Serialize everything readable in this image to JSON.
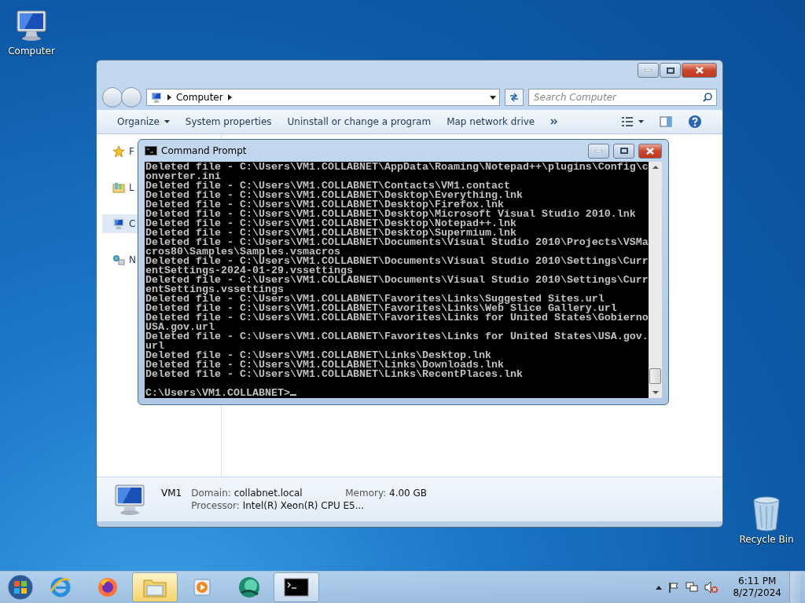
{
  "desktop_icons": [
    {
      "kind": "computer",
      "label": "Computer"
    },
    {
      "kind": "recycle",
      "label": "Recycle Bin"
    }
  ],
  "explorer": {
    "crumbs": [
      "Computer"
    ],
    "search": {
      "placeholder": "Search Computer"
    },
    "toolbar": [
      {
        "label": "Organize",
        "menu": true
      },
      {
        "label": "System properties",
        "menu": false
      },
      {
        "label": "Uninstall or change a program",
        "menu": false
      },
      {
        "label": "Map network drive",
        "menu": false
      }
    ],
    "nav_items": [
      {
        "kind": "star",
        "label": "F",
        "selected": false
      },
      {
        "kind": "library",
        "label": "L",
        "selected": false
      },
      {
        "kind": "computer",
        "label": "C",
        "selected": true
      },
      {
        "kind": "network",
        "label": "N",
        "selected": false
      }
    ],
    "details": {
      "name": "VM1",
      "fields": [
        {
          "label": "Domain:",
          "value": "collabnet.local"
        },
        {
          "label": "Memory:",
          "value": "4.00 GB"
        },
        {
          "label": "Processor:",
          "value": "Intel(R) Xeon(R) CPU E5..."
        }
      ]
    }
  },
  "console": {
    "title": "Command Prompt",
    "lines": [
      "Deleted file - C:\\Users\\VM1.COLLABNET\\AppData\\Roaming\\Notepad++\\plugins\\Config\\c",
      "onverter.ini",
      "Deleted file - C:\\Users\\VM1.COLLABNET\\Contacts\\VM1.contact",
      "Deleted file - C:\\Users\\VM1.COLLABNET\\Desktop\\Everything.lnk",
      "Deleted file - C:\\Users\\VM1.COLLABNET\\Desktop\\Firefox.lnk",
      "Deleted file - C:\\Users\\VM1.COLLABNET\\Desktop\\Microsoft Visual Studio 2010.lnk",
      "Deleted file - C:\\Users\\VM1.COLLABNET\\Desktop\\Notepad++.lnk",
      "Deleted file - C:\\Users\\VM1.COLLABNET\\Desktop\\Supermium.lnk",
      "Deleted file - C:\\Users\\VM1.COLLABNET\\Documents\\Visual Studio 2010\\Projects\\VSMa",
      "cros80\\Samples\\Samples.vsmacros",
      "Deleted file - C:\\Users\\VM1.COLLABNET\\Documents\\Visual Studio 2010\\Settings\\Curr",
      "entSettings-2024-01-29.vssettings",
      "Deleted file - C:\\Users\\VM1.COLLABNET\\Documents\\Visual Studio 2010\\Settings\\Curr",
      "entSettings.vssettings",
      "Deleted file - C:\\Users\\VM1.COLLABNET\\Favorites\\Links\\Suggested Sites.url",
      "Deleted file - C:\\Users\\VM1.COLLABNET\\Favorites\\Links\\Web Slice Gallery.url",
      "Deleted file - C:\\Users\\VM1.COLLABNET\\Favorites\\Links for United States\\Gobierno",
      "USA.gov.url",
      "Deleted file - C:\\Users\\VM1.COLLABNET\\Favorites\\Links for United States\\USA.gov.",
      "url",
      "Deleted file - C:\\Users\\VM1.COLLABNET\\Links\\Desktop.lnk",
      "Deleted file - C:\\Users\\VM1.COLLABNET\\Links\\Downloads.lnk",
      "Deleted file - C:\\Users\\VM1.COLLABNET\\Links\\RecentPlaces.lnk"
    ],
    "prompt": "C:\\Users\\VM1.COLLABNET>"
  },
  "taskbar": {
    "apps": [
      {
        "kind": "ie",
        "open": false,
        "hovered": false
      },
      {
        "kind": "firefox",
        "open": false,
        "hovered": false
      },
      {
        "kind": "explorer",
        "open": true,
        "hovered": true
      },
      {
        "kind": "media",
        "open": false,
        "hovered": false
      },
      {
        "kind": "app",
        "open": false,
        "hovered": false
      },
      {
        "kind": "cmd",
        "open": true,
        "hovered": false
      }
    ],
    "clock": {
      "time": "6:11 PM",
      "date": "8/27/2024"
    }
  }
}
